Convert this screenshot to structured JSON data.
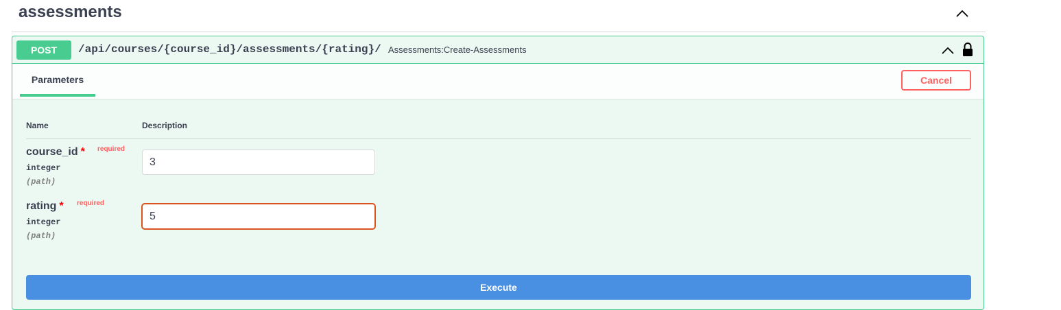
{
  "section": {
    "title": "assessments"
  },
  "operation": {
    "method": "POST",
    "path": "/api/courses/{course_id}/assessments/{rating}/",
    "summary": "Assessments:Create-Assessments",
    "method_color": "#49cc90",
    "chevron_icon": "chevron-up-icon",
    "lock_icon": "lock-icon"
  },
  "parameters_tab": {
    "label": "Parameters",
    "cancel_label": "Cancel"
  },
  "table": {
    "col_name": "Name",
    "col_description": "Description"
  },
  "params": [
    {
      "name": "course_id",
      "star": "*",
      "required": "required",
      "type": "integer",
      "in": "(path)",
      "value": "3"
    },
    {
      "name": "rating",
      "star": "*",
      "required": "required",
      "type": "integer",
      "in": "(path)",
      "value": "5"
    }
  ],
  "execute_label": "Execute",
  "colors": {
    "post": "#49cc90",
    "execute": "#4990e2",
    "cancel": "#ff6060",
    "focus": "#d9541e"
  }
}
